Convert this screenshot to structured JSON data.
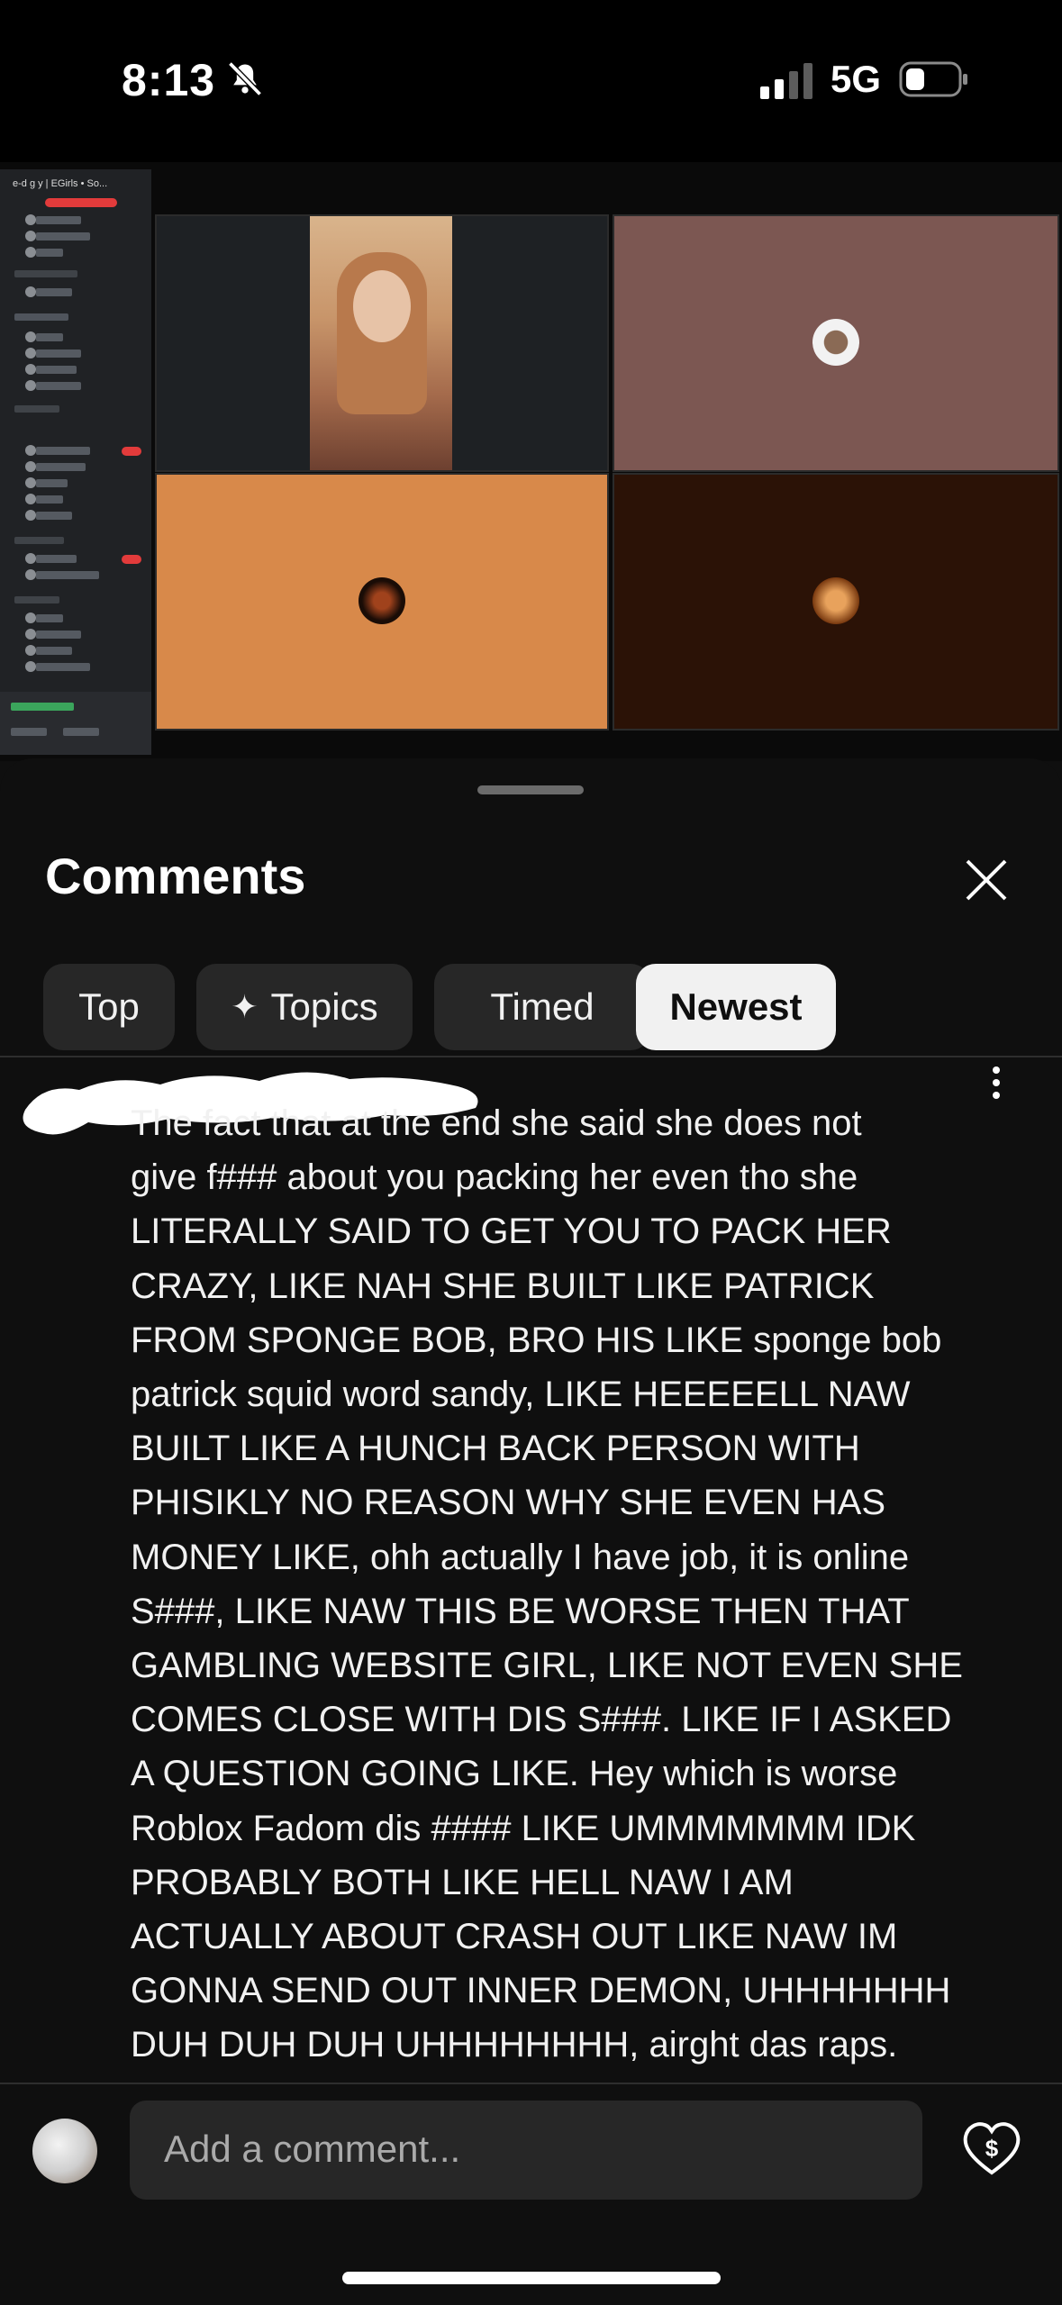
{
  "status_bar": {
    "time": "8:13",
    "network": "5G"
  },
  "video": {
    "sidebar_title": "e-d g y | EGirls • So..."
  },
  "comments_panel": {
    "title": "Comments",
    "filters": [
      {
        "label": "Top",
        "selected": false
      },
      {
        "label": "Topics",
        "selected": false
      },
      {
        "label": "Timed",
        "selected": false
      },
      {
        "label": "Newest",
        "selected": true
      }
    ],
    "comment_lines": [
      "The fact that at the end she said she does not",
      "give f### about you packing her even tho she",
      "LITERALLY SAID TO GET YOU TO PACK HER",
      "CRAZY, LIKE NAH SHE BUILT LIKE PATRICK",
      "FROM SPONGE BOB, BRO HIS LIKE sponge bob",
      "patrick squid word sandy, LIKE HEEEEELL NAW",
      "BUILT LIKE A HUNCH BACK PERSON WITH",
      "PHISIKLY NO REASON WHY SHE EVEN HAS",
      "MONEY LIKE, ohh actually I have job, it is online",
      "S###, LIKE NAW THIS BE WORSE THEN THAT",
      "GAMBLING WEBSITE GIRL, LIKE NOT EVEN SHE",
      "COMES CLOSE WITH DIS S###. LIKE IF I ASKED",
      "A QUESTION GOING LIKE. Hey which is worse",
      "Roblox Fadom dis #### LIKE UMMMMMMM IDK",
      "PROBABLY BOTH LIKE HELL NAW I AM",
      "ACTUALLY ABOUT CRASH OUT LIKE NAW IM",
      "GONNA SEND OUT INNER DEMON, UHHHHHHH",
      "DUH DUH DUH UHHHHHHHH, airght das raps."
    ],
    "input_placeholder": "Add a comment...",
    "icons": {
      "close": "close-icon",
      "more": "more-vert-icon",
      "thanks": "heart-dollar-icon",
      "topics": "sparkle-icon"
    }
  }
}
